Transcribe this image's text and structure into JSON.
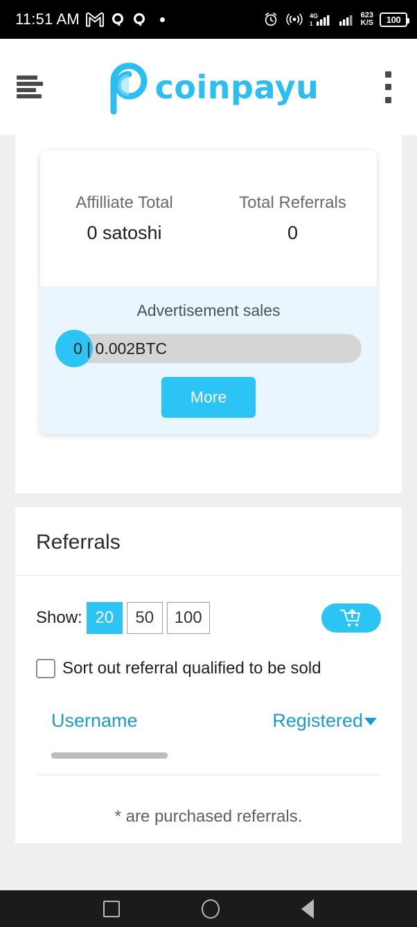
{
  "status_bar": {
    "time": "11:51 AM",
    "icons": [
      "gmail-icon",
      "quora-icon",
      "quora-icon",
      "dot-icon"
    ],
    "alarm_icon": "alarm-icon",
    "hotspot_icon": "hotspot-icon",
    "network_type": "4G",
    "data_rate_value": "623",
    "data_rate_unit": "K/S",
    "battery_level": "100"
  },
  "header": {
    "menu_icon": "hamburger-icon",
    "logo_text": "coinpayu",
    "overflow_icon": "kebab-icon",
    "brand_color": "#2bbef0"
  },
  "summary_card": {
    "stats": [
      {
        "label": "Affilliate Total",
        "value": "0 satoshi"
      },
      {
        "label": "Total Referrals",
        "value": "0"
      }
    ],
    "ad_sales": {
      "title": "Advertisement sales",
      "progress_label": "0 | 0.002BTC",
      "progress_current": "0",
      "progress_target": "0.002BTC",
      "progress_percent": 0,
      "more_label": "More",
      "accent_color": "#2bc4f5",
      "panel_color": "#e9f6fd"
    }
  },
  "referrals_card": {
    "title": "Referrals",
    "show_label": "Show:",
    "page_sizes": [
      {
        "label": "20",
        "selected": true
      },
      {
        "label": "50",
        "selected": false
      },
      {
        "label": "100",
        "selected": false
      }
    ],
    "buy_button_icon": "cart-upload-icon",
    "sort_checkbox": {
      "label": "Sort out referral qualified to be sold",
      "checked": false
    },
    "columns": [
      {
        "label": "Username",
        "sorted": false
      },
      {
        "label": "Registered",
        "sorted": true,
        "caret": "caret-down-icon"
      }
    ],
    "footnote": "* are purchased referrals.",
    "link_color": "#1b9ad1"
  },
  "nav_bar": {
    "buttons": [
      "recents-square-icon",
      "home-circle-icon",
      "back-triangle-icon"
    ]
  }
}
